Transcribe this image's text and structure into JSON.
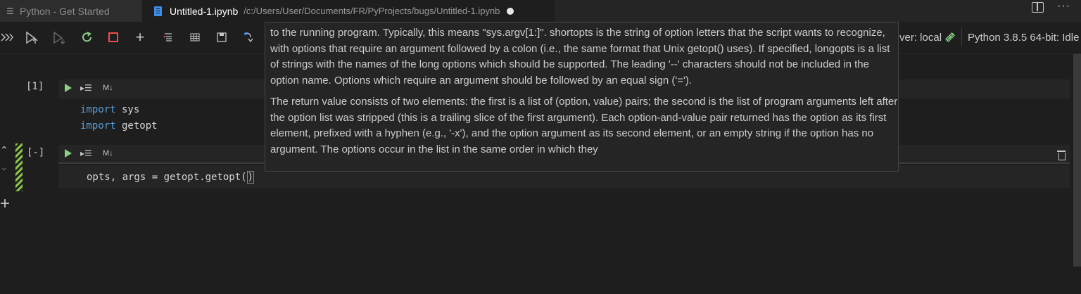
{
  "tabs": [
    {
      "label": "Python - Get Started",
      "active": false
    },
    {
      "label": "Untitled-1.ipynb",
      "path": "/c:/Users/User/Documents/FR/PyProjects/bugs/Untitled-1.ipynb",
      "active": true,
      "dirty": true
    }
  ],
  "window_actions": {
    "split": "split-editor-icon",
    "more": "···"
  },
  "toolbar": {
    "kernel_server": "ver: local",
    "kernel_name": "Python 3.8.5 64-bit: Idle",
    "icons": [
      "run-all-icon",
      "run-above-icon",
      "run-below-icon",
      "restart-icon",
      "interrupt-icon",
      "add-cell-icon",
      "clear-outputs-icon",
      "variables-icon",
      "save-icon",
      "export-icon"
    ]
  },
  "cells": [
    {
      "count": "[1]",
      "md_toggle": "M↓",
      "code": [
        [
          "import",
          " sys"
        ],
        [
          "import",
          " getopt"
        ]
      ]
    },
    {
      "count": "[-]",
      "md_toggle": "M↓",
      "code_prefix": "opts, args = getopt.getopt(",
      "code_suffix": ")"
    }
  ],
  "tooltip": {
    "paragraph1": "to the running program. Typically, this means \"sys.argv[1:]\". shortopts is the string of option letters that the script wants to recognize, with options that require an argument followed by a colon (i.e., the same format that Unix getopt() uses). If specified, longopts is a list of strings with the names of the long options which should be supported. The leading '--' characters should not be included in the option name. Options which require an argument should be followed by an equal sign ('=').",
    "paragraph2": "The return value consists of two elements: the first is a list of (option, value) pairs; the second is the list of program arguments left after the option list was stripped (this is a trailing slice of the first argument). Each option-and-value pair returned has the option as its first element, prefixed with a hyphen (e.g., '-x'), and the option argument as its second element, or an empty string if the option has no argument. The options occur in the list in the same order in which they"
  },
  "add_cell": "+",
  "colors": {
    "editor_bg": "#1e1e1e",
    "run_green": "#89d185",
    "interrupt_red": "#f14c4c",
    "keyword": "#569cd6",
    "stripe": "#8bc34a"
  }
}
